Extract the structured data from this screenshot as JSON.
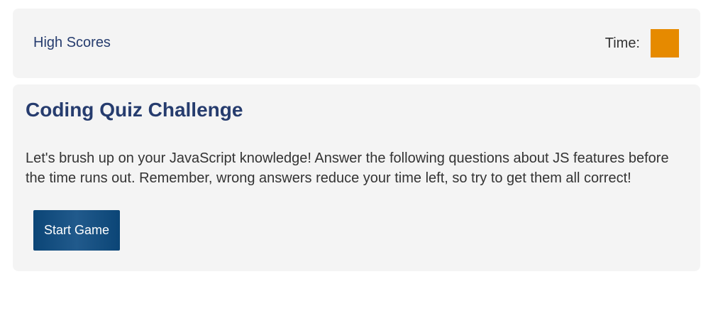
{
  "header": {
    "high_scores_label": "High Scores",
    "timer_label": "Time:",
    "timer_value": "",
    "timer_color": "#e68a00"
  },
  "main": {
    "title": "Coding Quiz Challenge",
    "intro": "Let's brush up on your JavaScript knowledge! Answer the following questions about JS features before the time runs out. Remember, wrong answers reduce your time left, so try to get them all correct!",
    "start_button_label": "Start Game"
  },
  "colors": {
    "accent_text": "#263c6e",
    "button_bg": "#0b4576",
    "card_bg": "#f4f4f4"
  }
}
